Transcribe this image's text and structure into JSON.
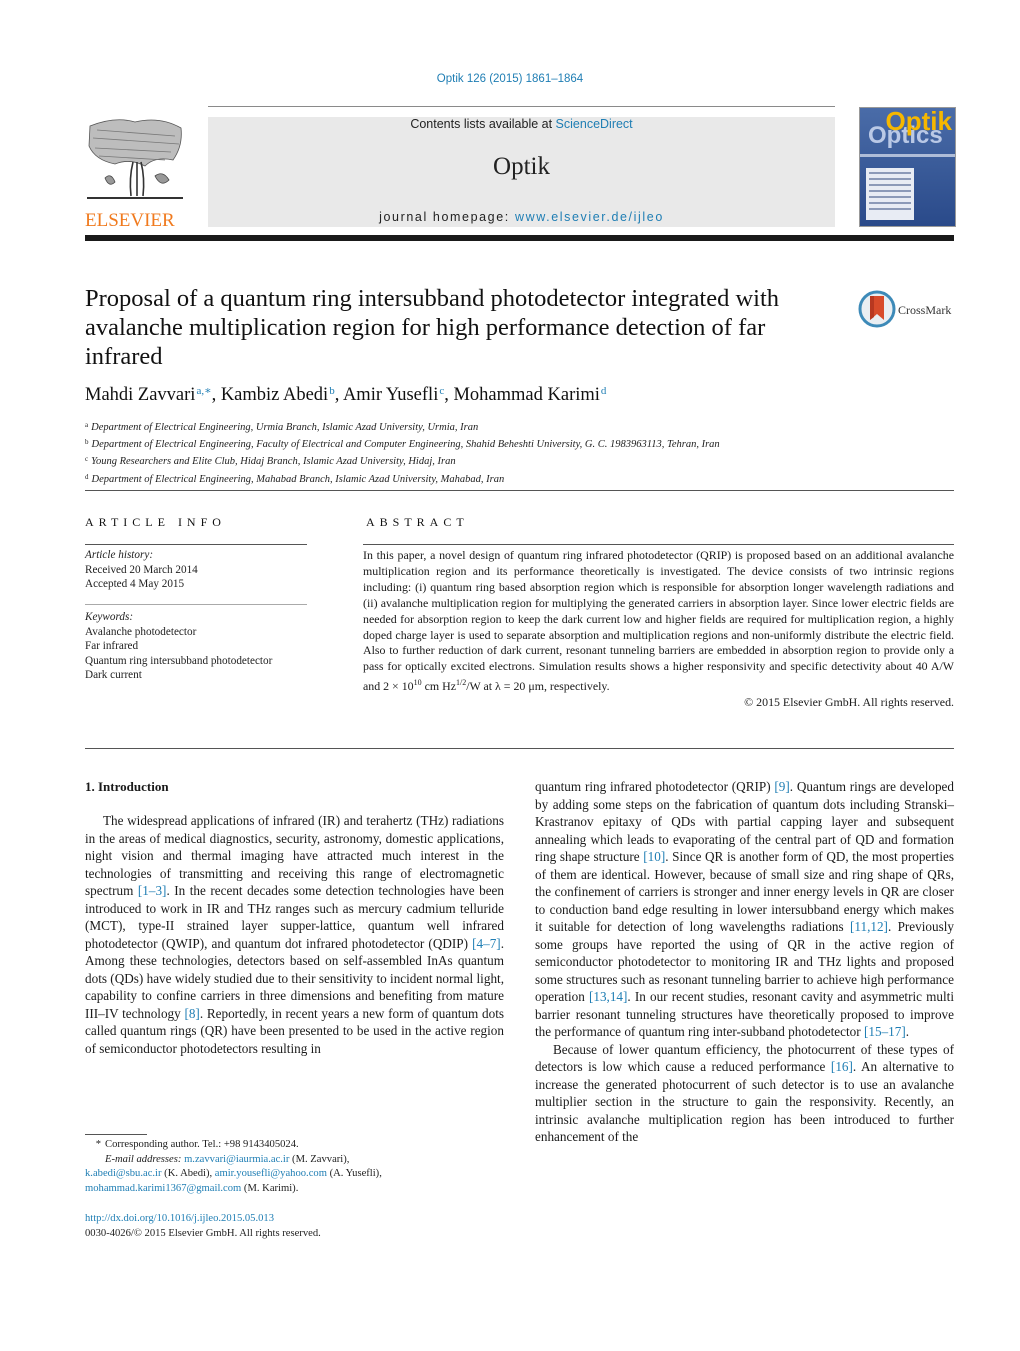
{
  "header": {
    "journal_ref": "Optik 126 (2015) 1861–1864",
    "contents_prefix": "Contents lists available at ",
    "contents_link": "ScienceDirect",
    "journal_name": "Optik",
    "homepage_prefix": "journal homepage: ",
    "homepage_link": "www.elsevier.de/ijleo",
    "publisher_logo_text": "ELSEVIER",
    "cover": {
      "title_top": "Optik",
      "title_bottom": "Optics"
    },
    "colors": {
      "link": "#1f7eb4",
      "elsevier_orange": "#f07a1e",
      "masthead_bg": "#e9e9e9"
    }
  },
  "article": {
    "title": "Proposal of a quantum ring intersubband photodetector integrated with avalanche multiplication region for high performance detection of far infrared",
    "crossmark_label": "CrossMark",
    "authors": [
      {
        "name": "Mahdi Zavvari",
        "sup": "a,∗",
        "sep": ", "
      },
      {
        "name": "Kambiz Abedi",
        "sup": "b",
        "sep": ", "
      },
      {
        "name": "Amir Yusefli",
        "sup": "c",
        "sep": ", "
      },
      {
        "name": "Mohammad Karimi",
        "sup": "d",
        "sep": ""
      }
    ],
    "affiliations": [
      {
        "key": "a",
        "text": "Department of Electrical Engineering, Urmia Branch, Islamic Azad University, Urmia, Iran"
      },
      {
        "key": "b",
        "text": "Department of Electrical Engineering, Faculty of Electrical and Computer Engineering, Shahid Beheshti University, G. C. 1983963113, Tehran, Iran"
      },
      {
        "key": "c",
        "text": "Young Researchers and Elite Club, Hidaj Branch, Islamic Azad University, Hidaj, Iran"
      },
      {
        "key": "d",
        "text": "Department of Electrical Engineering, Mahabad Branch, Islamic Azad University, Mahabad, Iran"
      }
    ]
  },
  "article_info": {
    "heading": "ARTICLE INFO",
    "history_label": "Article history:",
    "received": "Received 20 March 2014",
    "accepted": "Accepted 4 May 2015",
    "keywords_label": "Keywords:",
    "keywords": [
      "Avalanche photodetector",
      "Far infrared",
      "Quantum ring intersubband photodetector",
      "Dark current"
    ]
  },
  "abstract": {
    "heading": "ABSTRACT",
    "text_before": "In this paper, a novel design of quantum ring infrared photodetector (QRIP) is proposed based on an additional avalanche multiplication region and its performance theoretically is investigated. The device consists of two intrinsic regions including: (i) quantum ring based absorption region which is responsible for absorption longer wavelength radiations and (ii) avalanche multiplication region for multiplying the generated carriers in absorption layer. Since lower electric fields are needed for absorption region to keep the dark current low and higher fields are required for multiplication region, a highly doped charge layer is used to separate absorption and multiplication regions and non-uniformly distribute the electric field. Also to further reduction of dark current, resonant tunneling barriers are embedded in absorption region to provide only a pass for optically excited electrons. Simulation results shows a higher responsivity and specific detectivity about 40 A/W and 2 × 10",
    "exp1": "10",
    "text_mid": " cm Hz",
    "exp2": "1/2",
    "text_after": "/W at λ = 20 μm, respectively.",
    "copyright": "© 2015 Elsevier GmbH. All rights reserved."
  },
  "body": {
    "section_title": "1.  Introduction",
    "left_column": [
      {
        "t": "The widespread applications of infrared (IR) and terahertz (THz) radiations in the areas of medical diagnostics, security, astronomy, domestic applications, night vision and thermal imaging have attracted much interest in the technologies of transmitting and receiving this range of electromagnetic spectrum "
      },
      {
        "ref": "[1–3]"
      },
      {
        "t": ". In the recent decades some detection technologies have been introduced to work in IR and THz ranges such as mercury cadmium telluride (MCT), type-II strained layer supper-lattice, quantum well infrared photodetector (QWIP), and quantum dot infrared photodetector (QDIP) "
      },
      {
        "ref": "[4–7]"
      },
      {
        "t": ". Among these technologies, detectors based on self-assembled InAs quantum dots (QDs) have widely studied due to their sensitivity to incident normal light, capability to confine carriers in three dimensions and benefiting from mature III–IV technology "
      },
      {
        "ref": "[8]"
      },
      {
        "t": ". Reportedly, in recent years a new form of quantum dots called quantum rings (QR) have been presented to be used in the active region of semiconductor photodetectors resulting in"
      }
    ],
    "right_column_p1": [
      {
        "t": "quantum ring infrared photodetector (QRIP) "
      },
      {
        "ref": "[9]"
      },
      {
        "t": ". Quantum rings are developed by adding some steps on the fabrication of quantum dots including Stranski–Krastranov epitaxy of QDs with partial capping layer and subsequent annealing which leads to evaporating of the central part of QD and formation ring shape structure "
      },
      {
        "ref": "[10]"
      },
      {
        "t": ". Since QR is another form of QD, the most properties of them are identical. However, because of small size and ring shape of QRs, the confinement of carriers is stronger and inner energy levels in QR are closer to conduction band edge resulting in lower intersubband energy which makes it suitable for detection of long wavelengths radiations "
      },
      {
        "ref": "[11,12]"
      },
      {
        "t": ". Previously some groups have reported the using of QR in the active region of semiconductor photodetector to monitoring IR and THz lights and proposed some structures such as resonant tunneling barrier to achieve high performance operation "
      },
      {
        "ref": "[13,14]"
      },
      {
        "t": ". In our recent studies, resonant cavity and asymmetric multi barrier resonant tunneling structures have theoretically proposed to improve the performance of quantum ring inter-subband photodetector "
      },
      {
        "ref": "[15–17]"
      },
      {
        "t": "."
      }
    ],
    "right_column_p2": [
      {
        "t": "Because of lower quantum efficiency, the photocurrent of these types of detectors is low which cause a reduced performance "
      },
      {
        "ref": "[16]"
      },
      {
        "t": ". An alternative to increase the generated photocurrent of such detector is to use an avalanche multiplier section in the structure to gain the responsivity. Recently, an intrinsic avalanche multiplication region has been introduced to further enhancement of the"
      }
    ]
  },
  "footnote": {
    "star": "*",
    "corresponding": "Corresponding author. Tel.: +98 9143405024.",
    "email_label": "E-mail addresses:",
    "emails": [
      {
        "addr": "m.zavvari@iaurmia.ac.ir",
        "who": " (M. Zavvari),",
        "br": true
      },
      {
        "addr": "k.abedi@sbu.ac.ir",
        "who": " (K. Abedi), ",
        "br": false
      },
      {
        "addr": "amir.yousefli@yahoo.com",
        "who": " (A. Yusefli),",
        "br": true
      },
      {
        "addr": "mohammad.karimi1367@gmail.com",
        "who": " (M. Karimi).",
        "br": false
      }
    ],
    "doi": "http://dx.doi.org/10.1016/j.ijleo.2015.05.013",
    "issn": "0030-4026/© 2015 Elsevier GmbH. All rights reserved."
  }
}
